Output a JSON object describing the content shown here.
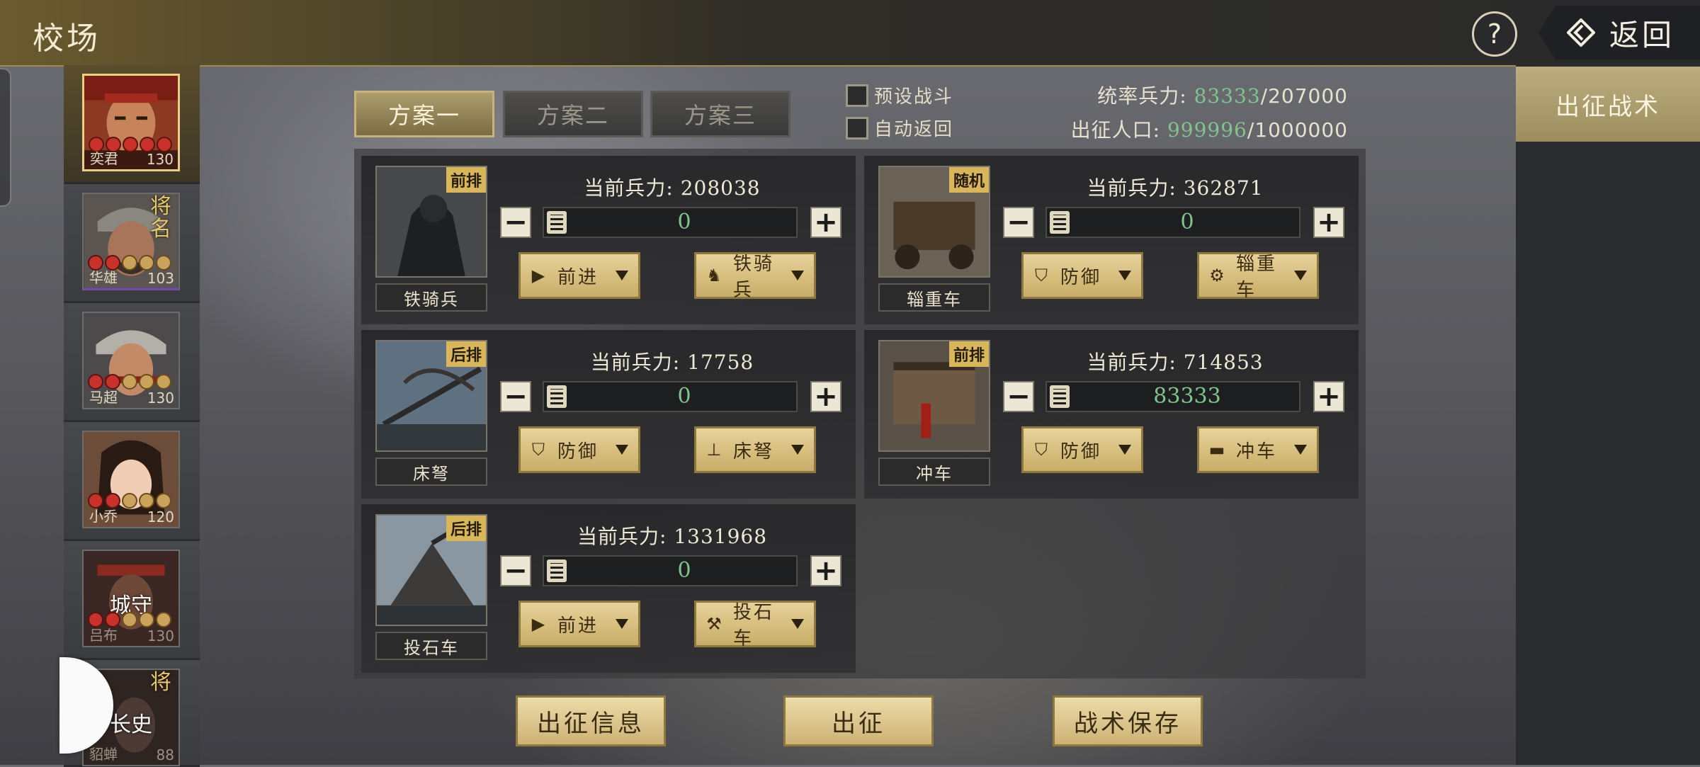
{
  "header": {
    "title": "校场",
    "help_label": "?",
    "back_label": "返回"
  },
  "heroes": [
    {
      "name": "奕君",
      "level": "130",
      "badge": "",
      "corner": "",
      "selected": true,
      "red_stars": 5
    },
    {
      "name": "华雄",
      "level": "103",
      "badge": "",
      "corner": "将名",
      "selected": false,
      "red_stars": 2
    },
    {
      "name": "马超",
      "level": "130",
      "badge": "",
      "corner": "",
      "selected": false,
      "red_stars": 2
    },
    {
      "name": "小乔",
      "level": "120",
      "badge": "",
      "corner": "",
      "selected": false,
      "red_stars": 2
    },
    {
      "name": "吕布",
      "level": "130",
      "badge": "城守",
      "corner": "",
      "selected": false,
      "red_stars": 2
    },
    {
      "name": "貂蝉",
      "level": "88",
      "badge": "长史",
      "corner": "将",
      "selected": false,
      "red_stars": 0
    }
  ],
  "plans": {
    "tabs": [
      "方案一",
      "方案二",
      "方案三"
    ],
    "active": 0
  },
  "options": {
    "preset_battle": "预设战斗",
    "auto_return": "自动返回"
  },
  "stats": {
    "command_label": "统率兵力:",
    "command_value": "83333",
    "command_max": "/207000",
    "pop_label": "出征人口:",
    "pop_value": "999996",
    "pop_max": "/1000000"
  },
  "units": [
    {
      "name": "铁骑兵",
      "tag": "前排",
      "troops_label": "当前兵力:",
      "troops": "208038",
      "qty": "0",
      "action": "前进",
      "action_icon": "forward",
      "type_label": "铁骑兵",
      "type_icon": "horse"
    },
    {
      "name": "辎重车",
      "tag": "随机",
      "troops_label": "当前兵力:",
      "troops": "362871",
      "qty": "0",
      "action": "防御",
      "action_icon": "shield",
      "type_label": "辎重车",
      "type_icon": "wheel"
    },
    {
      "name": "床弩",
      "tag": "后排",
      "troops_label": "当前兵力:",
      "troops": "17758",
      "qty": "0",
      "action": "防御",
      "action_icon": "shield",
      "type_label": "床弩",
      "type_icon": "ballista"
    },
    {
      "name": "冲车",
      "tag": "前排",
      "troops_label": "当前兵力:",
      "troops": "714853",
      "qty": "83333",
      "action": "防御",
      "action_icon": "shield",
      "type_label": "冲车",
      "type_icon": "ram"
    },
    {
      "name": "投石车",
      "tag": "后排",
      "troops_label": "当前兵力:",
      "troops": "1331968",
      "qty": "0",
      "action": "前进",
      "action_icon": "forward",
      "type_label": "投石车",
      "type_icon": "catapult"
    }
  ],
  "tactic": {
    "label": "出征战术"
  },
  "bottom": {
    "info": "出征信息",
    "go": "出征",
    "save": "战术保存"
  },
  "colors": {
    "gold": "#d9b65a",
    "green_value": "#7fc48e",
    "panel": "#2a2b2d"
  }
}
